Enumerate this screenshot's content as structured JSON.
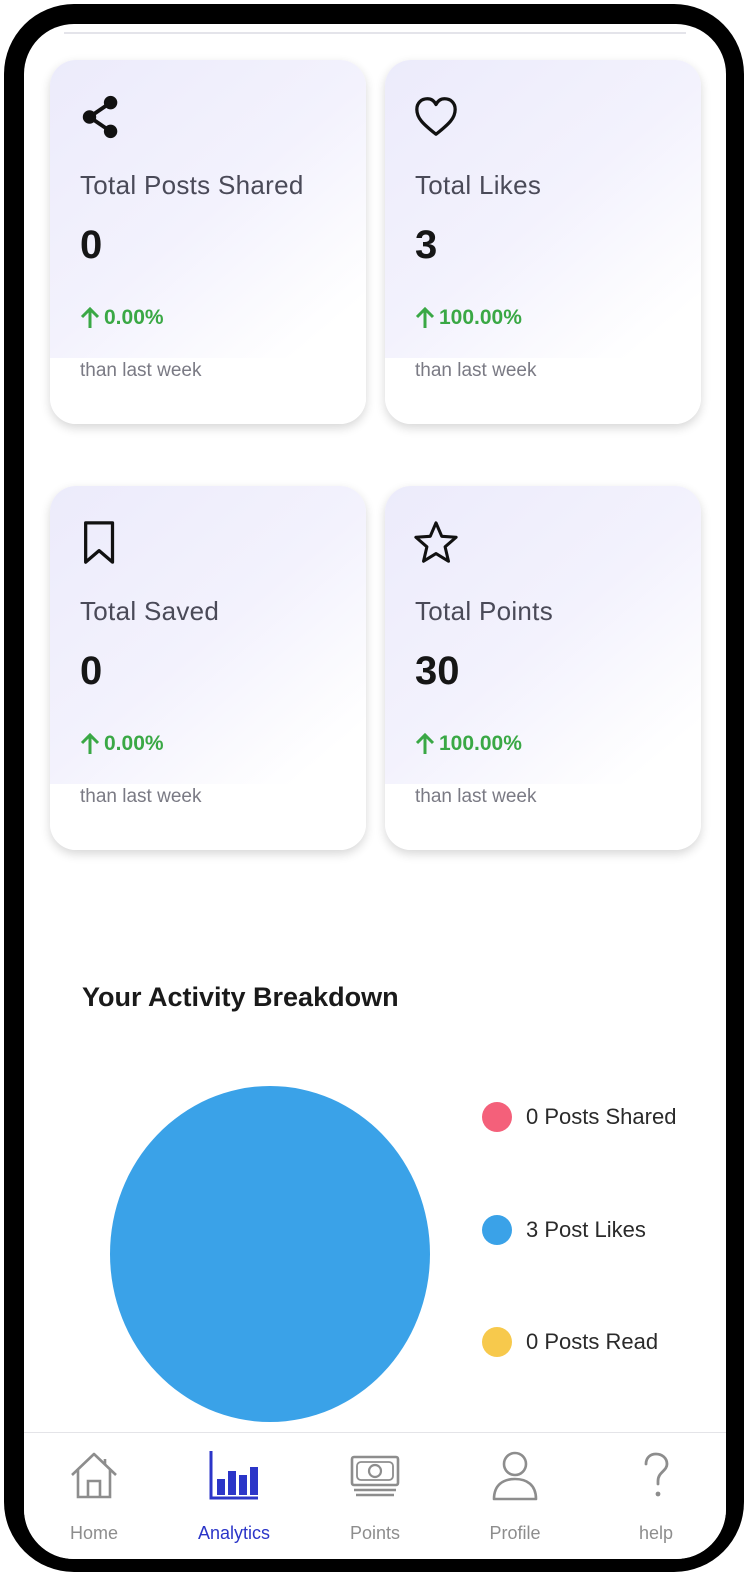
{
  "stats": [
    {
      "icon": "share-icon",
      "label": "Total Posts Shared",
      "value": "0",
      "change": "0.00%",
      "subtext": "than last week"
    },
    {
      "icon": "heart-icon",
      "label": "Total Likes",
      "value": "3",
      "change": "100.00%",
      "subtext": "than last week"
    },
    {
      "icon": "bookmark-icon",
      "label": "Total Saved",
      "value": "0",
      "change": "0.00%",
      "subtext": "than last week"
    },
    {
      "icon": "star-icon",
      "label": "Total Points",
      "value": "30",
      "change": "100.00%",
      "subtext": "than last week"
    }
  ],
  "breakdown": {
    "title": "Your Activity Breakdown",
    "legend": [
      {
        "label": "0 Posts Shared",
        "color": "#f4607a"
      },
      {
        "label": "3 Post Likes",
        "color": "#3aa2e8"
      },
      {
        "label": "0 Posts Read",
        "color": "#f7c94c"
      }
    ]
  },
  "chart_data": {
    "type": "pie",
    "categories": [
      "Posts Shared",
      "Post Likes",
      "Posts Read"
    ],
    "values": [
      0,
      3,
      0
    ],
    "colors": [
      "#f4607a",
      "#3aa2e8",
      "#f7c94c"
    ],
    "legend_position": "right"
  },
  "nav": {
    "active": "Analytics",
    "accent_color": "#2b35c8",
    "items": [
      {
        "label": "Home",
        "icon": "home-icon"
      },
      {
        "label": "Analytics",
        "icon": "bar-chart-icon"
      },
      {
        "label": "Points",
        "icon": "banknote-icon"
      },
      {
        "label": "Profile",
        "icon": "user-icon"
      },
      {
        "label": "help",
        "icon": "question-icon"
      }
    ]
  }
}
